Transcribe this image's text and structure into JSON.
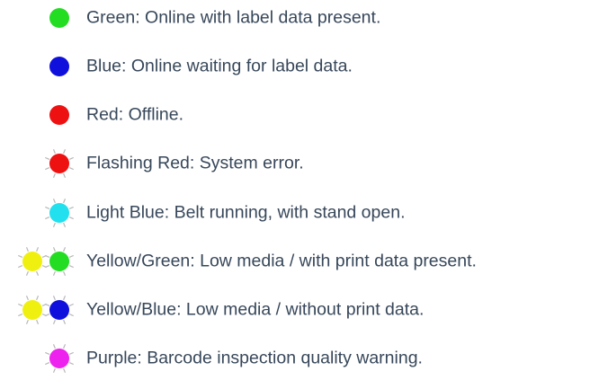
{
  "legend": {
    "items": [
      {
        "label": "Green: Online with label data present.",
        "lights": [
          {
            "color": "#22dd22",
            "flashing": false
          }
        ]
      },
      {
        "label": "Blue: Online waiting for label data.",
        "lights": [
          {
            "color": "#1010dd",
            "flashing": false
          }
        ]
      },
      {
        "label": "Red: Offline.",
        "lights": [
          {
            "color": "#ee1111",
            "flashing": false
          }
        ]
      },
      {
        "label": "Flashing Red: System error.",
        "lights": [
          {
            "color": "#ee1111",
            "flashing": true
          }
        ]
      },
      {
        "label": "Light Blue: Belt running, with stand open.",
        "lights": [
          {
            "color": "#22e0ee",
            "flashing": true
          }
        ]
      },
      {
        "label": "Yellow/Green: Low media / with print data present.",
        "lights": [
          {
            "color": "#f0f010",
            "flashing": true
          },
          {
            "color": "#22dd22",
            "flashing": true
          }
        ]
      },
      {
        "label": "Yellow/Blue: Low media / without print data.",
        "lights": [
          {
            "color": "#f0f010",
            "flashing": true
          },
          {
            "color": "#1010dd",
            "flashing": true
          }
        ]
      },
      {
        "label": "Purple: Barcode inspection quality warning.",
        "lights": [
          {
            "color": "#ee22ee",
            "flashing": true
          }
        ]
      }
    ]
  }
}
